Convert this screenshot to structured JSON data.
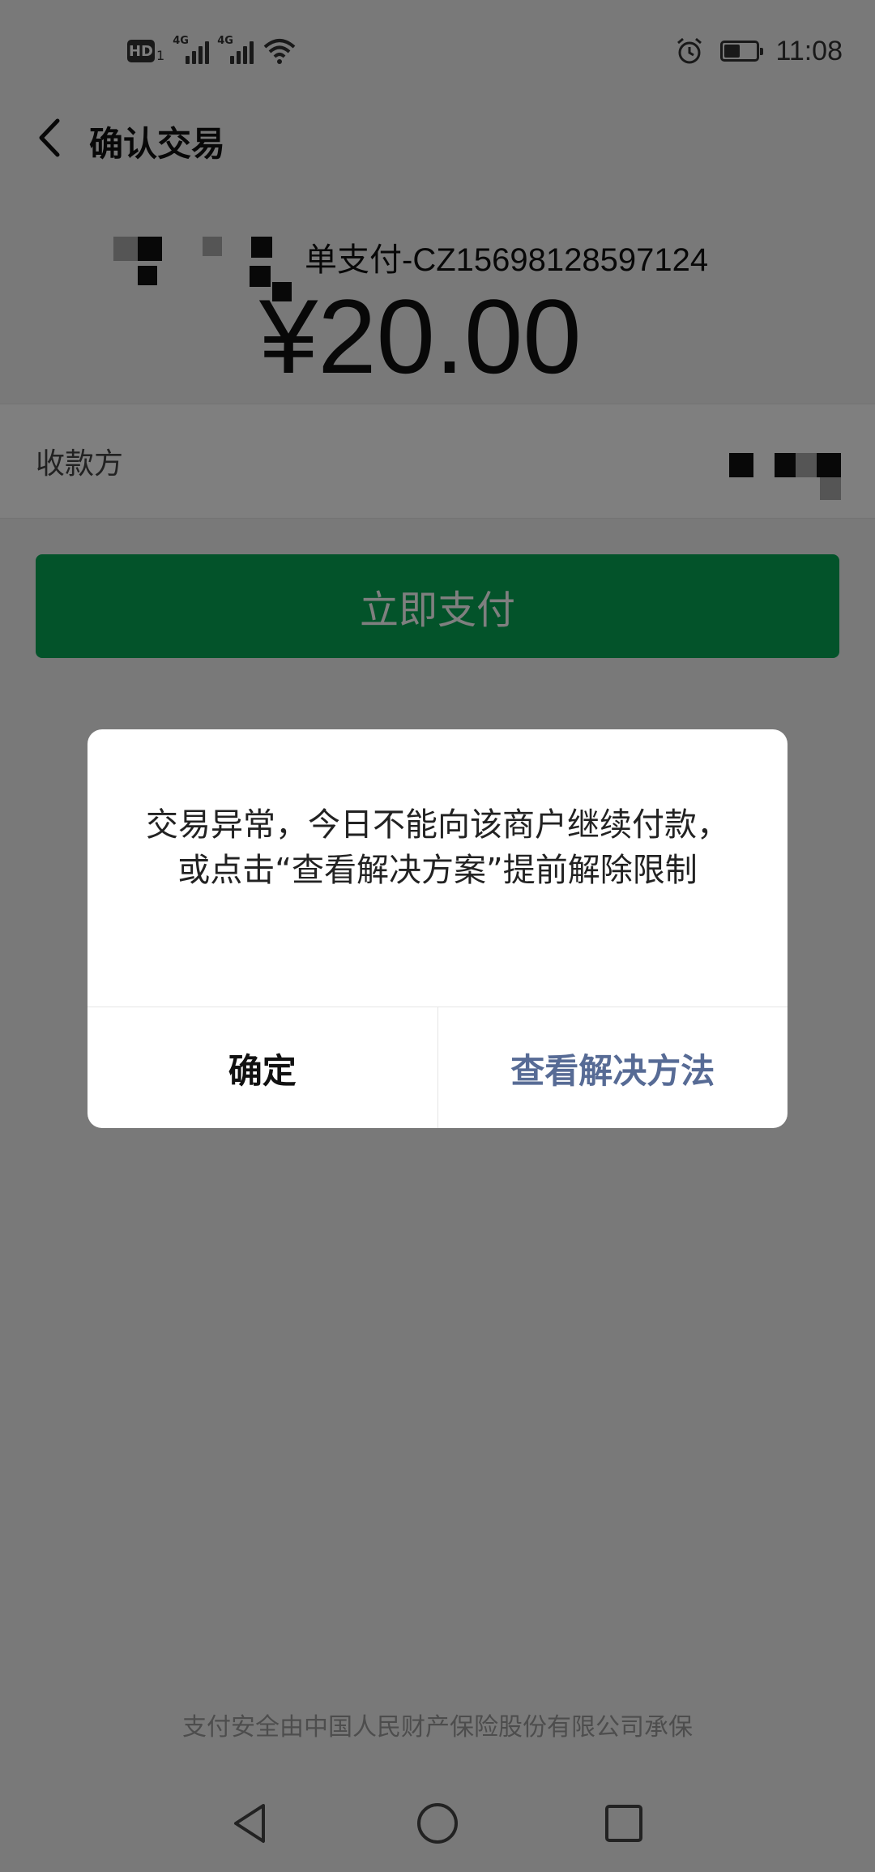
{
  "status_bar": {
    "hd_label": "HD",
    "sim_number": "1",
    "network_1": "4G",
    "network_2": "4G",
    "icons": [
      "signal-icon",
      "signal-icon",
      "wifi-icon",
      "alarm-icon",
      "battery-icon"
    ],
    "time": "11:08"
  },
  "header": {
    "title": "确认交易",
    "back_icon": "chevron-left-icon"
  },
  "payment": {
    "order_text": "单支付-CZ15698128597124",
    "amount": "¥20.00",
    "payee_label": "收款方",
    "pay_button_label": "立即支付"
  },
  "footer": {
    "note": "支付安全由中国人民财产保险股份有限公司承保"
  },
  "dialog": {
    "message": "交易异常，今日不能向该商户继续付款，或点击“查看解决方案”提前解除限制",
    "confirm_label": "确定",
    "solution_label": "查看解决方法"
  },
  "nav_bar": {
    "icons": [
      "back-triangle-icon",
      "home-circle-icon",
      "recents-square-icon"
    ]
  },
  "colors": {
    "accent_green": "#07a755",
    "link_blue": "#576b95",
    "overlay": "rgba(0,0,0,0.5)"
  }
}
